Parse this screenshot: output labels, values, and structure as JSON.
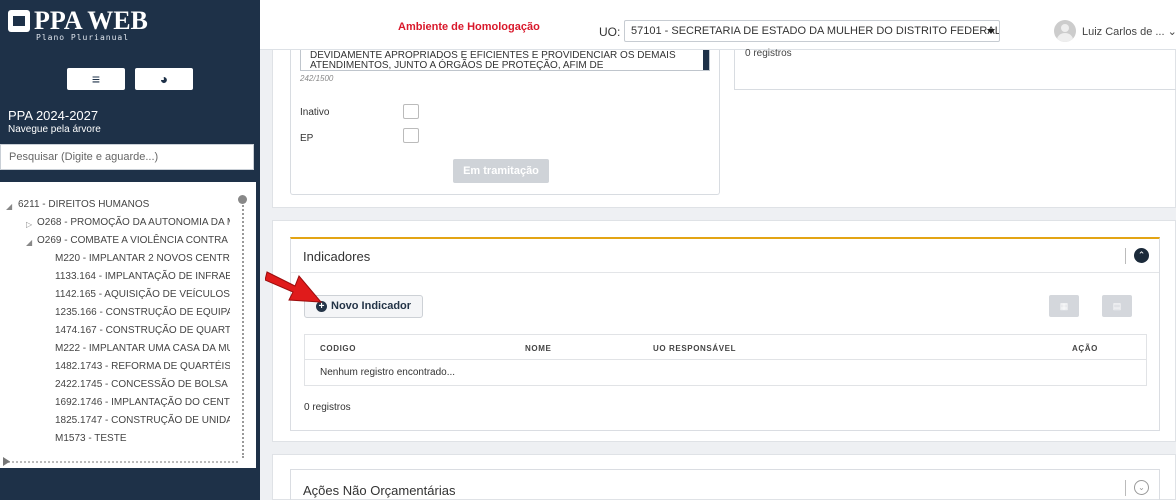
{
  "app": {
    "logo_title": "PPA WEB",
    "logo_subtitle": "Plano Plurianual"
  },
  "sidebar": {
    "menu_icon": "≡",
    "chart_icon": "◕",
    "ppa_title": "PPA 2024-2027",
    "ppa_subtitle": "Navegue pela árvore",
    "search_placeholder": "Pesquisar (Digite e aguarde...)",
    "tree": [
      {
        "label": "6211 - DIREITOS HUMANOS",
        "expanded": true
      },
      {
        "label": "O268 - PROMOÇÃO DA AUTONOMIA DA M",
        "expanded": false
      },
      {
        "label": "O269 - COMBATE A VIOLÊNCIA CONTRA /",
        "expanded": true
      },
      {
        "label": "M220 - IMPLANTAR 2 NOVOS CENTR("
      },
      {
        "label": "1133.164 - IMPLANTAÇÃO DE INFRAE"
      },
      {
        "label": "1142.165 - AQUISIÇÃO DE VEÍCULOS"
      },
      {
        "label": "1235.166 - CONSTRUÇÃO DE EQUIPA"
      },
      {
        "label": "1474.167 - CONSTRUÇÃO DE QUART:"
      },
      {
        "label": "M222 - IMPLANTAR UMA CASA DA MU"
      },
      {
        "label": "1482.1743 - REFORMA DE QUARTÉIS"
      },
      {
        "label": "2422.1745 - CONCESSÃO DE BOLSA I"
      },
      {
        "label": "1692.1746 - IMPLANTAÇÃO DO CENTI"
      },
      {
        "label": "1825.1747 - CONSTRUÇÃO DE UNIDA"
      },
      {
        "label": "M1573 - TESTE"
      }
    ]
  },
  "header": {
    "environment": "Ambiente de Homologação",
    "uo_label": "UO:",
    "uo_value": "57101 - SECRETARIA DE ESTADO DA MULHER DO DISTRITO FEDERAL",
    "user_name": "Luiz Carlos de ... ⌄"
  },
  "form": {
    "textarea_text": "DEVIDAMENTE APROPRIADOS E EFICIENTES E PROVIDENCIAR OS DEMAIS ATENDIMENTOS, JUNTO A ÓRGÃOS DE PROTEÇÃO, AFIM DE",
    "char_counter": "242/1500",
    "inativo_label": "Inativo",
    "ep_label": "EP",
    "tramitacao_button": "Em tramitação",
    "right_registros": "0 registros"
  },
  "indicadores": {
    "title": "Indicadores",
    "toggle_icon": "⌃",
    "new_button": "Novo Indicador",
    "export_icon_1": "▦",
    "export_icon_2": "▤",
    "columns": [
      "CODIGO",
      "NOME",
      "UO RESPONSÁVEL",
      "AÇÃO"
    ],
    "empty_message": "Nenhum registro encontrado...",
    "registros": "0 registros"
  },
  "acoes": {
    "title": "Ações Não Orçamentárias",
    "toggle_icon": "⌄"
  },
  "colors": {
    "sidebar_bg": "#1e3148",
    "env_red": "#d9182b",
    "panel_accent": "#e3a414",
    "annotation_arrow": "#e01b1b"
  }
}
